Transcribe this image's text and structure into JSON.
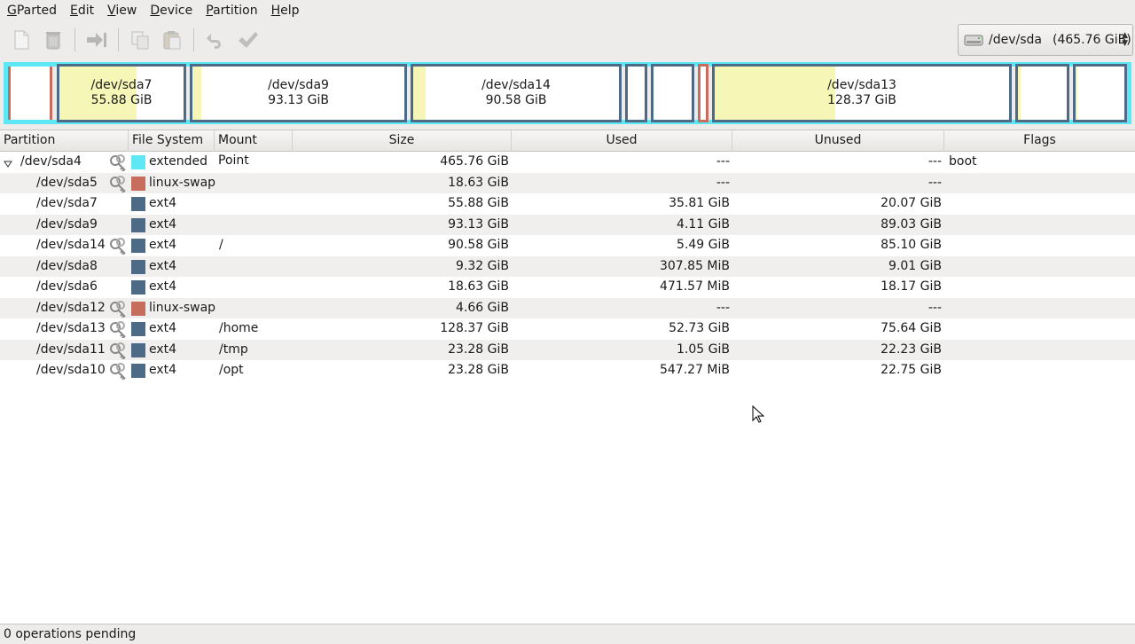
{
  "menubar": {
    "items": [
      {
        "mnemonic": "G",
        "rest": "Parted"
      },
      {
        "mnemonic": "E",
        "rest": "dit"
      },
      {
        "mnemonic": "V",
        "rest": "iew"
      },
      {
        "mnemonic": "D",
        "rest": "evice"
      },
      {
        "mnemonic": "P",
        "rest": "artition"
      },
      {
        "mnemonic": "H",
        "rest": "elp"
      }
    ]
  },
  "toolbar": {
    "icons": [
      "new-icon",
      "delete-icon",
      "resize-move-icon",
      "copy-icon",
      "paste-icon",
      "undo-icon",
      "apply-icon"
    ]
  },
  "device": {
    "name": "/dev/sda",
    "size": "(465.76 GiB)",
    "icon": "harddisk-icon"
  },
  "visual": {
    "blocks": [
      {
        "label": "",
        "size": ""
      },
      {
        "label": "/dev/sda7",
        "size": "55.88 GiB"
      },
      {
        "label": "/dev/sda9",
        "size": "93.13 GiB"
      },
      {
        "label": "/dev/sda14",
        "size": "90.58 GiB"
      },
      {
        "label": "",
        "size": ""
      },
      {
        "label": "",
        "size": ""
      },
      {
        "label": "",
        "size": ""
      },
      {
        "label": "/dev/sda13",
        "size": "128.37 GiB"
      },
      {
        "label": "",
        "size": ""
      },
      {
        "label": "",
        "size": ""
      }
    ],
    "colors": {
      "ext4": "#4d6a86",
      "swap": "#c76d5e",
      "extended": "#5ee8f5",
      "used": "#f6f7b7"
    }
  },
  "table": {
    "headers": {
      "partition": "Partition",
      "filesystem": "File System",
      "mountpoint": "Mount Point",
      "size": "Size",
      "used": "Used",
      "unused": "Unused",
      "flags": "Flags"
    },
    "rows": [
      {
        "partition": "/dev/sda4",
        "fs": "extended",
        "mount": "",
        "size": "465.76 GiB",
        "used": "---",
        "unused": "---",
        "flags": "boot"
      },
      {
        "partition": "/dev/sda5",
        "fs": "linux-swap",
        "mount": "",
        "size": "18.63 GiB",
        "used": "---",
        "unused": "---",
        "flags": ""
      },
      {
        "partition": "/dev/sda7",
        "fs": "ext4",
        "mount": "",
        "size": "55.88 GiB",
        "used": "35.81 GiB",
        "unused": "20.07 GiB",
        "flags": ""
      },
      {
        "partition": "/dev/sda9",
        "fs": "ext4",
        "mount": "",
        "size": "93.13 GiB",
        "used": "4.11 GiB",
        "unused": "89.03 GiB",
        "flags": ""
      },
      {
        "partition": "/dev/sda14",
        "fs": "ext4",
        "mount": "/",
        "size": "90.58 GiB",
        "used": "5.49 GiB",
        "unused": "85.10 GiB",
        "flags": ""
      },
      {
        "partition": "/dev/sda8",
        "fs": "ext4",
        "mount": "",
        "size": "9.32 GiB",
        "used": "307.85 MiB",
        "unused": "9.01 GiB",
        "flags": ""
      },
      {
        "partition": "/dev/sda6",
        "fs": "ext4",
        "mount": "",
        "size": "18.63 GiB",
        "used": "471.57 MiB",
        "unused": "18.17 GiB",
        "flags": ""
      },
      {
        "partition": "/dev/sda12",
        "fs": "linux-swap",
        "mount": "",
        "size": "4.66 GiB",
        "used": "---",
        "unused": "---",
        "flags": ""
      },
      {
        "partition": "/dev/sda13",
        "fs": "ext4",
        "mount": "/home",
        "size": "128.37 GiB",
        "used": "52.73 GiB",
        "unused": "75.64 GiB",
        "flags": ""
      },
      {
        "partition": "/dev/sda11",
        "fs": "ext4",
        "mount": "/tmp",
        "size": "23.28 GiB",
        "used": "1.05 GiB",
        "unused": "22.23 GiB",
        "flags": ""
      },
      {
        "partition": "/dev/sda10",
        "fs": "ext4",
        "mount": "/opt",
        "size": "23.28 GiB",
        "used": "547.27 MiB",
        "unused": "22.75 GiB",
        "flags": ""
      }
    ]
  },
  "status": {
    "text": "0 operations pending"
  }
}
